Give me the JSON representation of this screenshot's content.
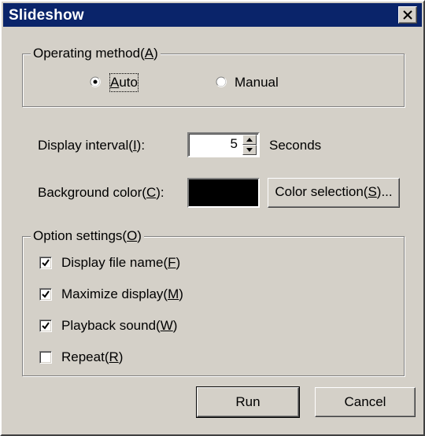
{
  "window": {
    "title": "Slideshow"
  },
  "operating_method": {
    "legend_text": "Operating method(",
    "legend_key": "A",
    "legend_close": ")",
    "options": [
      {
        "label_key": "A",
        "label_rest": "uto",
        "selected": true
      },
      {
        "label_key": "",
        "label_rest": "Manual",
        "selected": false
      }
    ]
  },
  "display_interval": {
    "label_text": "Display interval(",
    "label_key": "I",
    "label_close": "):",
    "value": "5",
    "unit": "Seconds"
  },
  "background_color": {
    "label_text": "Background color(",
    "label_key": "C",
    "label_close": "):",
    "value_color": "#000000",
    "button_text": "Color selection(",
    "button_key": "S",
    "button_close": ")..."
  },
  "option_settings": {
    "legend_text": "Option settings(",
    "legend_key": "O",
    "legend_close": ")",
    "items": [
      {
        "text": "Display file name(",
        "key": "F",
        "close": ")",
        "checked": true
      },
      {
        "text": "Maximize display(",
        "key": "M",
        "close": ")",
        "checked": true
      },
      {
        "text": "Playback sound(",
        "key": "W",
        "close": ")",
        "checked": true
      },
      {
        "text": "Repeat(",
        "key": "R",
        "close": ")",
        "checked": false
      }
    ]
  },
  "buttons": {
    "run": "Run",
    "cancel": "Cancel"
  },
  "colors": {
    "titlebar": "#0a246a",
    "face": "#d4d0c8"
  }
}
